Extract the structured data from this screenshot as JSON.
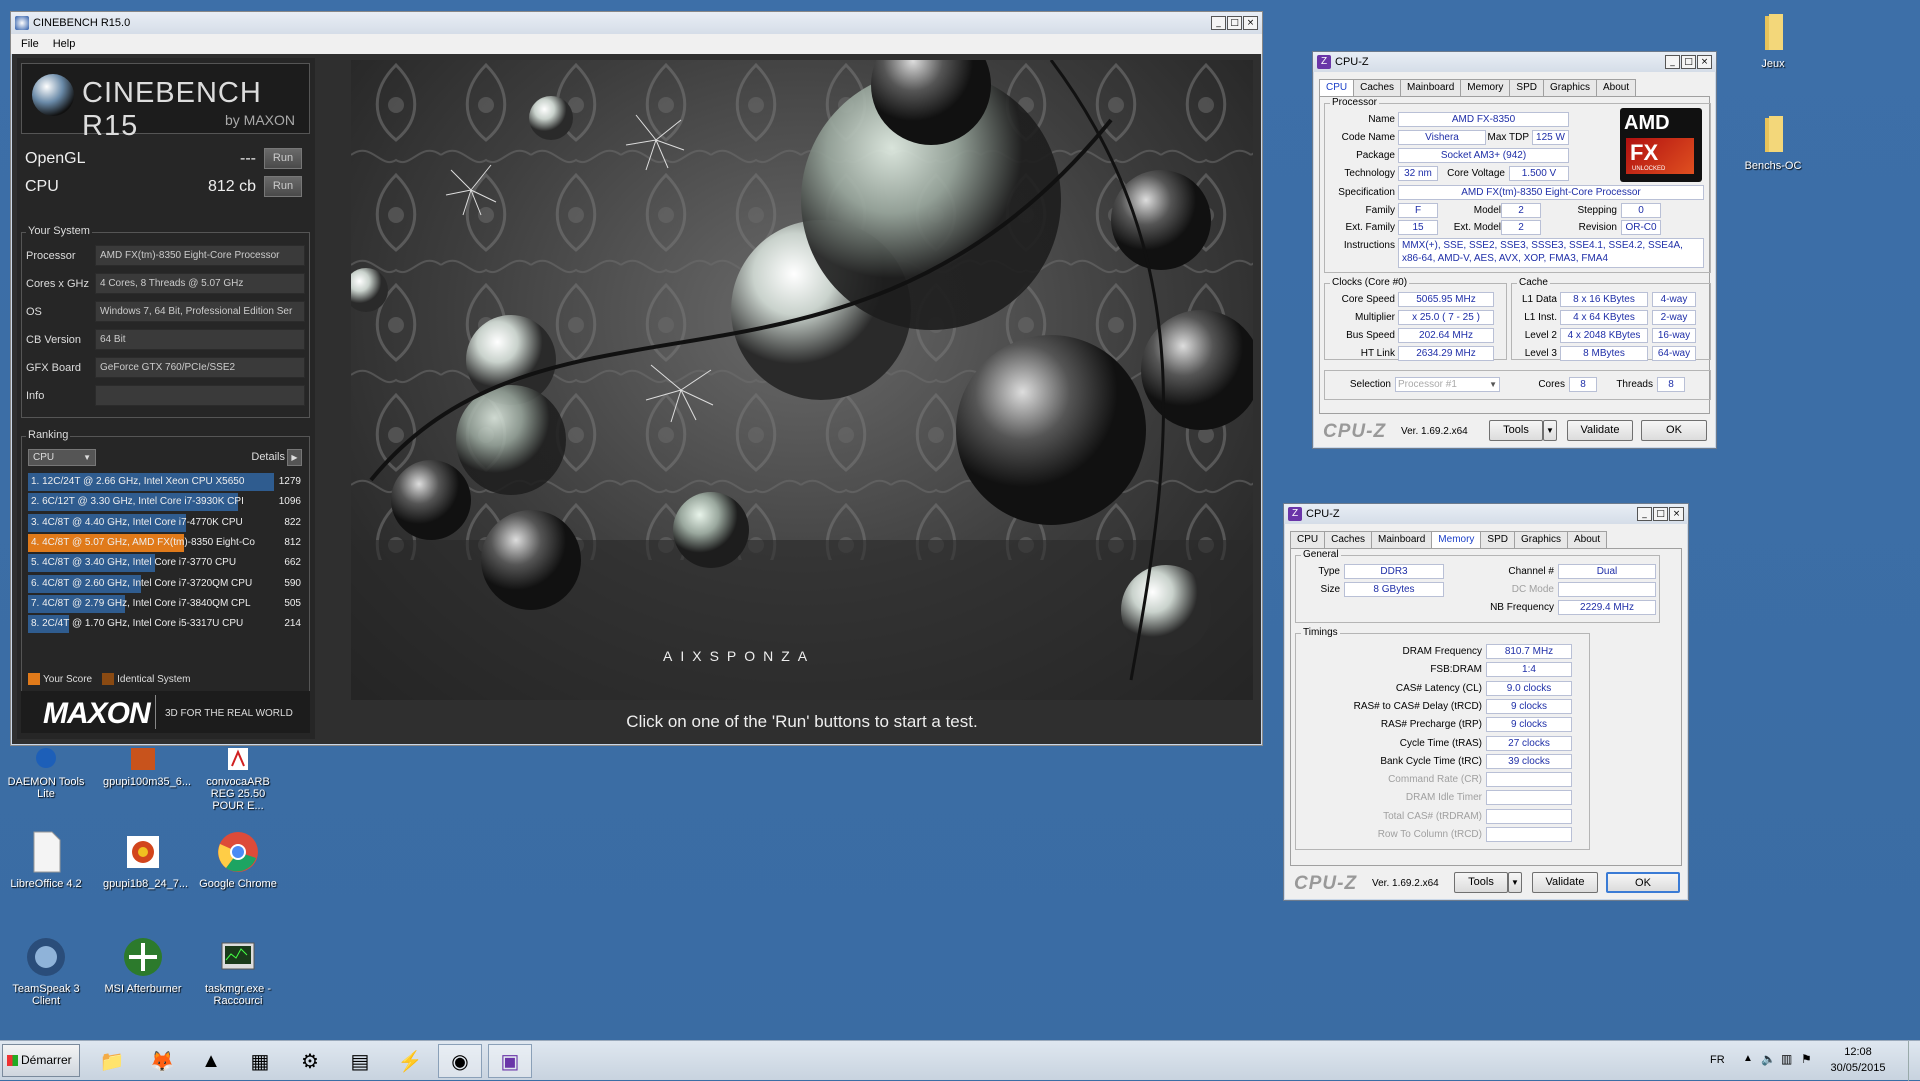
{
  "desktop": {
    "icons_right": [
      {
        "label": "Jeux",
        "icon": "folder-icon"
      },
      {
        "label": "Benchs-OC",
        "icon": "folder-icon"
      }
    ],
    "icons_left": [
      {
        "label": "DAEMON Tools Lite",
        "icon": "daemon-tools-icon"
      },
      {
        "label": "gpupi100m35_6...",
        "icon": "gpupi-icon"
      },
      {
        "label": "convocaARB REG 25.50 POUR E...",
        "icon": "pdf-icon"
      },
      {
        "label": "LibreOffice 4.2",
        "icon": "libreoffice-icon"
      },
      {
        "label": "gpupi1b8_24_7...",
        "icon": "gpupi-icon"
      },
      {
        "label": "Google Chrome",
        "icon": "chrome-icon"
      },
      {
        "label": "TeamSpeak 3 Client",
        "icon": "teamspeak-icon"
      },
      {
        "label": "MSI Afterburner",
        "icon": "afterburner-icon"
      },
      {
        "label": "taskmgr.exe - Raccourci",
        "icon": "taskmgr-icon"
      }
    ]
  },
  "cinebench": {
    "window_title": "CINEBENCH R15.0",
    "menu": [
      "File",
      "Help"
    ],
    "logo_name": "CINEBENCH R15",
    "logo_by": "by MAXON",
    "tests": [
      {
        "label": "OpenGL",
        "value": "---",
        "run": "Run"
      },
      {
        "label": "CPU",
        "value": "812 cb",
        "run": "Run"
      }
    ],
    "your_system_title": "Your System",
    "system": [
      {
        "key": "Processor",
        "value": "AMD FX(tm)-8350 Eight-Core Processor"
      },
      {
        "key": "Cores x GHz",
        "value": "4 Cores, 8 Threads @ 5.07 GHz"
      },
      {
        "key": "OS",
        "value": "Windows 7, 64 Bit, Professional Edition Ser"
      },
      {
        "key": "CB Version",
        "value": "64 Bit"
      },
      {
        "key": "GFX Board",
        "value": "GeForce GTX 760/PCIe/SSE2"
      },
      {
        "key": "Info",
        "value": ""
      }
    ],
    "ranking_title": "Ranking",
    "ranking_select": "CPU",
    "ranking_details": "Details",
    "ranking": [
      {
        "text": "1. 12C/24T @ 2.66 GHz, Intel Xeon CPU X5650",
        "score": "1279",
        "fill": 1.0,
        "highlight": false
      },
      {
        "text": "2. 6C/12T @ 3.30 GHz,  Intel Core i7-3930K CPI",
        "score": "1096",
        "fill": 0.857,
        "highlight": false
      },
      {
        "text": "3. 4C/8T @ 4.40 GHz, Intel Core i7-4770K CPU",
        "score": "822",
        "fill": 0.643,
        "highlight": false
      },
      {
        "text": "4. 4C/8T @ 5.07 GHz, AMD FX(tm)-8350 Eight-Co",
        "score": "812",
        "fill": 0.635,
        "highlight": true
      },
      {
        "text": "5. 4C/8T @ 3.40 GHz,  Intel Core i7-3770 CPU",
        "score": "662",
        "fill": 0.518,
        "highlight": false
      },
      {
        "text": "6. 4C/8T @ 2.60 GHz, Intel Core i7-3720QM CPU",
        "score": "590",
        "fill": 0.461,
        "highlight": false
      },
      {
        "text": "7. 4C/8T @ 2.79 GHz,  Intel Core i7-3840QM CPL",
        "score": "505",
        "fill": 0.395,
        "highlight": false
      },
      {
        "text": "8. 2C/4T @ 1.70 GHz,  Intel Core i5-3317U CPU",
        "score": "214",
        "fill": 0.167,
        "highlight": false
      }
    ],
    "legend_your_score": "Your Score",
    "legend_identical": "Identical System",
    "maxon_logo": "MAXON",
    "maxon_tagline": "3D FOR THE REAL WORLD",
    "render_watermark": "AIXSPONZA",
    "status": "Click on one of the 'Run' buttons to start a test."
  },
  "cpuz1": {
    "title": "CPU-Z",
    "tabs": [
      "CPU",
      "Caches",
      "Mainboard",
      "Memory",
      "SPD",
      "Graphics",
      "About"
    ],
    "active_tab": "CPU",
    "processor_legend": "Processor",
    "name_label": "Name",
    "name": "AMD FX-8350",
    "codename_label": "Code Name",
    "codename": "Vishera",
    "maxtdp_label": "Max TDP",
    "maxtdp": "125 W",
    "package_label": "Package",
    "package": "Socket AM3+ (942)",
    "technology_label": "Technology",
    "technology": "32 nm",
    "corevoltage_label": "Core Voltage",
    "corevoltage": "1.500 V",
    "spec_label": "Specification",
    "spec": "AMD FX(tm)-8350 Eight-Core Processor",
    "family_label": "Family",
    "family": "F",
    "model_label": "Model",
    "model": "2",
    "stepping_label": "Stepping",
    "stepping": "0",
    "extfamily_label": "Ext. Family",
    "extfamily": "15",
    "extmodel_label": "Ext. Model",
    "extmodel": "2",
    "revision_label": "Revision",
    "revision": "OR-C0",
    "instructions_label": "Instructions",
    "instructions_1": "MMX(+), SSE, SSE2, SSE3, SSSE3, SSE4.1, SSE4.2, SSE4A,",
    "instructions_2": "x86-64, AMD-V, AES, AVX, XOP, FMA3, FMA4",
    "clocks_legend": "Clocks (Core #0)",
    "corespeed_label": "Core Speed",
    "corespeed": "5065.95 MHz",
    "multiplier_label": "Multiplier",
    "multiplier": "x 25.0 ( 7 - 25 )",
    "busspeed_label": "Bus Speed",
    "busspeed": "202.64 MHz",
    "htlink_label": "HT Link",
    "htlink": "2634.29 MHz",
    "cache_legend": "Cache",
    "l1data_label": "L1 Data",
    "l1data": "8 x 16 KBytes",
    "l1data_way": "4-way",
    "l1inst_label": "L1 Inst.",
    "l1inst": "4 x 64 KBytes",
    "l1inst_way": "2-way",
    "l2_label": "Level 2",
    "l2": "4 x 2048 KBytes",
    "l2_way": "16-way",
    "l3_label": "Level 3",
    "l3": "8 MBytes",
    "l3_way": "64-way",
    "selection_label": "Selection",
    "selection": "Processor #1",
    "cores_label": "Cores",
    "cores": "8",
    "threads_label": "Threads",
    "threads": "8",
    "logo_text": "CPU-Z",
    "version": "Ver. 1.69.2.x64",
    "tools": "Tools",
    "validate": "Validate",
    "ok": "OK",
    "amd_logo": "AMD",
    "fx_logo": "FX",
    "fx_unlocked": "UNLOCKED"
  },
  "cpuz2": {
    "title": "CPU-Z",
    "tabs": [
      "CPU",
      "Caches",
      "Mainboard",
      "Memory",
      "SPD",
      "Graphics",
      "About"
    ],
    "active_tab": "Memory",
    "general_legend": "General",
    "type_label": "Type",
    "type": "DDR3",
    "channel_label": "Channel #",
    "channel": "Dual",
    "size_label": "Size",
    "size": "8 GBytes",
    "dcmode_label": "DC Mode",
    "dcmode": "",
    "nbfreq_label": "NB Frequency",
    "nbfreq": "2229.4 MHz",
    "timings_legend": "Timings",
    "timings": [
      {
        "label": "DRAM Frequency",
        "value": "810.7 MHz",
        "enabled": true
      },
      {
        "label": "FSB:DRAM",
        "value": "1:4",
        "enabled": true
      },
      {
        "label": "CAS# Latency (CL)",
        "value": "9.0 clocks",
        "enabled": true
      },
      {
        "label": "RAS# to CAS# Delay (tRCD)",
        "value": "9 clocks",
        "enabled": true
      },
      {
        "label": "RAS# Precharge (tRP)",
        "value": "9 clocks",
        "enabled": true
      },
      {
        "label": "Cycle Time (tRAS)",
        "value": "27 clocks",
        "enabled": true
      },
      {
        "label": "Bank Cycle Time (tRC)",
        "value": "39 clocks",
        "enabled": true
      },
      {
        "label": "Command Rate (CR)",
        "value": "",
        "enabled": false
      },
      {
        "label": "DRAM Idle Timer",
        "value": "",
        "enabled": false
      },
      {
        "label": "Total CAS# (tRDRAM)",
        "value": "",
        "enabled": false
      },
      {
        "label": "Row To Column (tRCD)",
        "value": "",
        "enabled": false
      }
    ],
    "logo_text": "CPU-Z",
    "version": "Ver. 1.69.2.x64",
    "tools": "Tools",
    "validate": "Validate",
    "ok": "OK"
  },
  "taskbar": {
    "start": "Démarrer",
    "lang": "FR",
    "time": "12:08",
    "date": "30/05/2015",
    "apps": [
      "explorer-icon",
      "firefox-icon",
      "vlc-icon",
      "calculator-icon",
      "tool-icon",
      "monitor-icon",
      "flash-icon",
      "cinebench-icon",
      "cpuz-icon"
    ]
  },
  "colors": {
    "desktop": "#3a6ea5",
    "highlight_score": "#e07a1a",
    "identical_system": "#8a4a12",
    "rank_bar": "#2f5c8f",
    "cpuz_value_text": "#1f2fa8"
  }
}
